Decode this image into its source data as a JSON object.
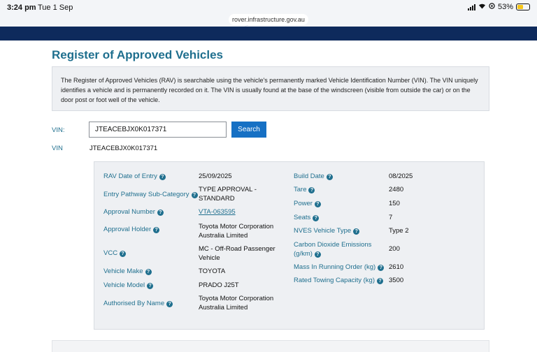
{
  "status_bar": {
    "time": "3:24 pm",
    "date": "Tue 1 Sep",
    "battery": "53%"
  },
  "browser": {
    "url": "rover.infrastructure.gov.au"
  },
  "page": {
    "title": "Register of Approved Vehicles",
    "intro": "The Register of Approved Vehicles (RAV) is searchable using the vehicle's permanently marked Vehicle Identification Number (VIN). The VIN uniquely identifies a vehicle and is permanently recorded on it. The VIN is usually found at the base of the windscreen (visible from outside the car) or on the door post or foot well of the vehicle."
  },
  "search": {
    "label": "VIN:",
    "value": "JTEACEBJX0K017371",
    "button": "Search"
  },
  "result": {
    "vin_label": "VIN",
    "vin_value": "JTEACEBJX0K017371"
  },
  "details": {
    "left": [
      {
        "label": "RAV Date of Entry",
        "value": "25/09/2025",
        "help": "?"
      },
      {
        "label": "Entry Pathway Sub-Category",
        "value": "TYPE APPROVAL - STANDARD",
        "help": "?"
      },
      {
        "label": "Approval Number",
        "value": "VTA-063595",
        "help": "?"
      },
      {
        "label": "Approval Holder",
        "value": "Toyota Motor Corporation Australia Limited",
        "help": "?"
      },
      {
        "label": "VCC",
        "value": "MC - Off-Road Passenger Vehicle",
        "help": "?"
      },
      {
        "label": "Vehicle Make",
        "value": "TOYOTA",
        "help": "?"
      },
      {
        "label": "Vehicle Model",
        "value": "PRADO J25T",
        "help": "?"
      },
      {
        "label": "Authorised By Name",
        "value": "Toyota Motor Corporation Australia Limited",
        "help": "?"
      }
    ],
    "right": [
      {
        "label": "Build Date",
        "value": "08/2025",
        "help": "?"
      },
      {
        "label": "Tare",
        "value": "2480",
        "help": "?"
      },
      {
        "label": "Power",
        "value": "150",
        "help": "?"
      },
      {
        "label": "Seats",
        "value": "7",
        "help": "?"
      },
      {
        "label": "NVES Vehicle Type",
        "value": "Type 2",
        "help": "?"
      },
      {
        "label": "Carbon Dioxide Emissions (g/km)",
        "value": "200",
        "help": "?"
      },
      {
        "label": "Mass In Running Order (kg)",
        "value": "2610",
        "help": "?"
      },
      {
        "label": "Rated Towing Capacity (kg)",
        "value": "3500",
        "help": "?"
      }
    ]
  },
  "colors": {
    "accent": "#1f6f8e",
    "button": "#1670c4",
    "navy": "#0e2a5c",
    "panel": "#eef0f3"
  }
}
